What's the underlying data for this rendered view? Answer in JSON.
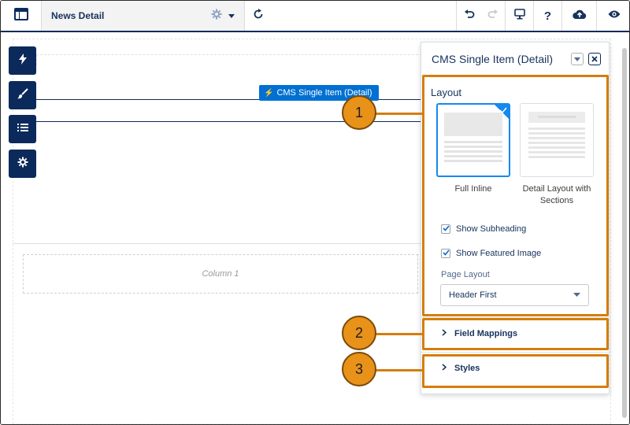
{
  "toolbar": {
    "page_title": "News Detail",
    "icons": [
      "layout-icon",
      "gear-icon",
      "caret-down-icon",
      "refresh-icon",
      "undo-icon",
      "redo-icon",
      "desktop-icon",
      "help-icon",
      "publish-cloud-icon",
      "preview-eye-icon"
    ]
  },
  "canvas": {
    "component_label": "CMS Single Item (Detail)",
    "column_label": "Column 1",
    "side_buttons": [
      "lightning-icon",
      "brush-icon",
      "list-icon",
      "gear-icon"
    ]
  },
  "panel": {
    "title": "CMS Single Item (Detail)",
    "layout": {
      "heading": "Layout",
      "options": [
        {
          "label": "Full Inline",
          "selected": true
        },
        {
          "label": "Detail Layout with Sections",
          "selected": false
        }
      ]
    },
    "checkboxes": [
      {
        "label": "Show Subheading",
        "checked": true
      },
      {
        "label": "Show Featured Image",
        "checked": true
      }
    ],
    "page_layout": {
      "label": "Page Layout",
      "value": "Header First"
    },
    "sections": [
      {
        "label": "Field Mappings"
      },
      {
        "label": "Styles"
      }
    ]
  },
  "callouts": [
    "1",
    "2",
    "3"
  ],
  "colors": {
    "navy": "#0b2a5b",
    "accent_blue": "#0070d2",
    "highlight_orange": "#d47e0c",
    "callout_fill": "#e8921a"
  }
}
